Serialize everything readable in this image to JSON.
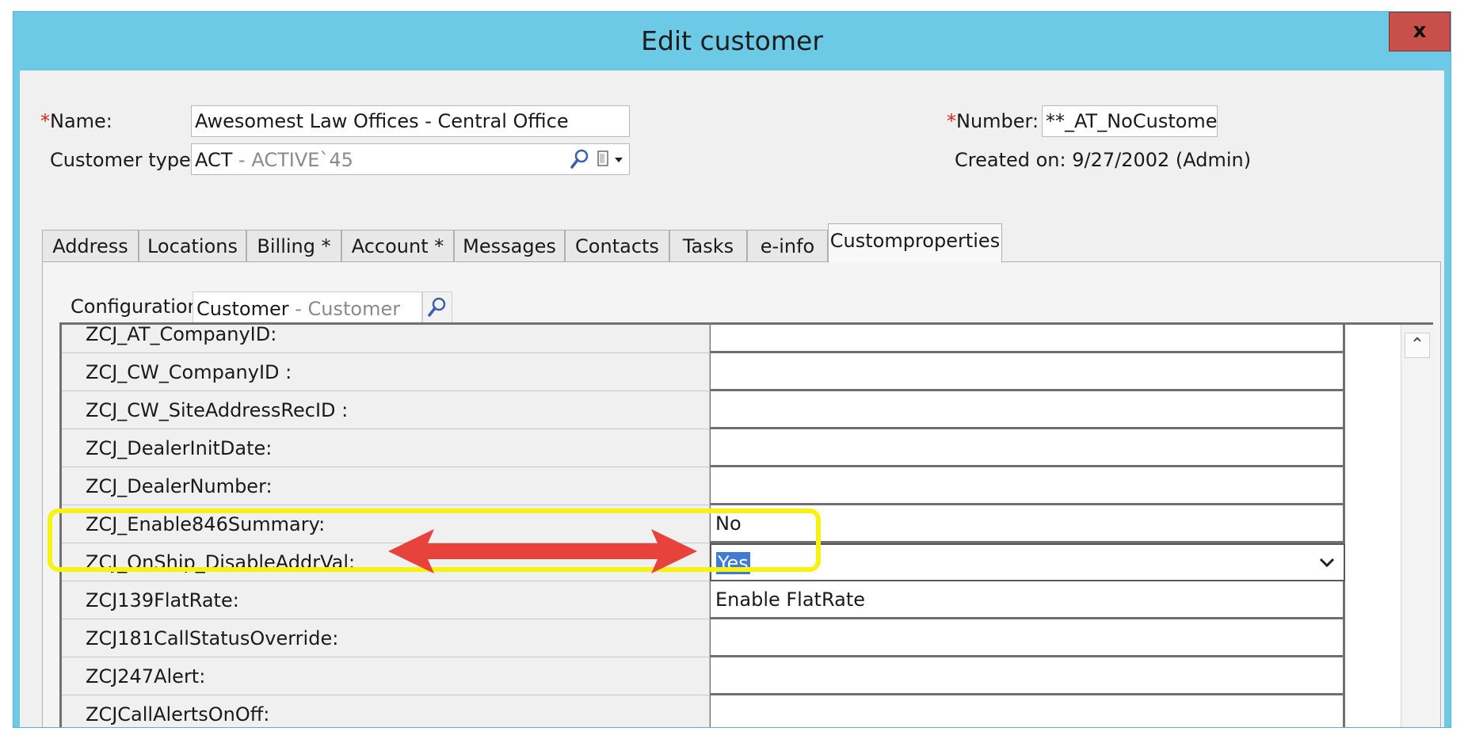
{
  "window": {
    "title": "Edit customer",
    "close_label": "x"
  },
  "header": {
    "name_required": "*",
    "name_label": "Name:",
    "name_value": "Awesomest Law Offices - Central Office",
    "customer_type_label": "Customer type:",
    "customer_type_code": "ACT",
    "customer_type_desc": " - ACTIVE`45",
    "number_required": "*",
    "number_label": "Number:",
    "number_value": "**_AT_NoCustomer",
    "created_on": "Created on: 9/27/2002 (Admin)"
  },
  "tabs": [
    {
      "label": "Address"
    },
    {
      "label": "Locations"
    },
    {
      "label": "Billing *"
    },
    {
      "label": "Account *"
    },
    {
      "label": "Messages"
    },
    {
      "label": "Contacts"
    },
    {
      "label": "Tasks"
    },
    {
      "label": "e-info"
    },
    {
      "label": "Customproperties"
    }
  ],
  "config": {
    "label": "Configuration:",
    "value": "Customer",
    "desc": " - Customer"
  },
  "properties": [
    {
      "name": "ZCJ_AT_CompanyID:",
      "value": ""
    },
    {
      "name": "ZCJ_CW_CompanyID :",
      "value": ""
    },
    {
      "name": "ZCJ_CW_SiteAddressRecID :",
      "value": ""
    },
    {
      "name": "ZCJ_DealerInitDate:",
      "value": ""
    },
    {
      "name": "ZCJ_DealerNumber:",
      "value": ""
    },
    {
      "name": "ZCJ_Enable846Summary:",
      "value": "No"
    },
    {
      "name": "ZCJ_OnShip_DisableAddrVal:",
      "value": "Yes"
    },
    {
      "name": "ZCJ139FlatRate:",
      "value": "Enable FlatRate"
    },
    {
      "name": "ZCJ181CallStatusOverride:",
      "value": ""
    },
    {
      "name": "ZCJ247Alert:",
      "value": ""
    },
    {
      "name": "ZCJCallAlertsOnOff:",
      "value": ""
    }
  ],
  "colors": {
    "title_bar": "#6ccae6",
    "close": "#c7504a",
    "highlight": "#f5f214",
    "arrow": "#e8423c",
    "selection": "#3d7bd6"
  }
}
